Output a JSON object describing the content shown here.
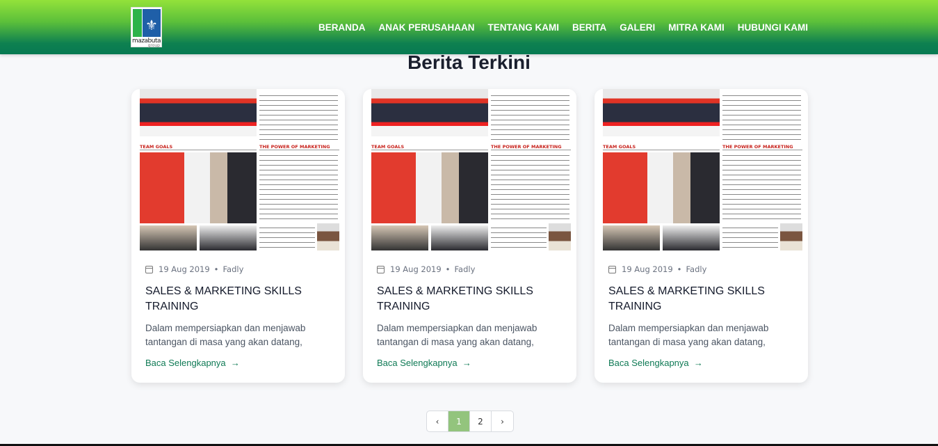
{
  "header": {
    "logo_text": "mazabuta",
    "logo_subtext": "group",
    "nav": [
      "BERANDA",
      "ANAK PERUSAHAAN",
      "TENTANG KAMI",
      "BERITA",
      "GALERI",
      "MITRA KAMI",
      "HUBUNGI KAMI"
    ]
  },
  "section_title": "Berita Terkini",
  "cards": [
    {
      "image_headings": [
        "TEAM GOALS",
        "THE POWER OF MARKETING"
      ],
      "date": "19 Aug 2019",
      "author": "Fadly",
      "title": "SALES & MARKETING SKILLS TRAINING",
      "excerpt": "Dalam mempersiapkan dan menjawab tantangan di masa yang akan datang,",
      "link": "Baca Selengkapnya"
    },
    {
      "image_headings": [
        "TEAM GOALS",
        "THE POWER OF MARKETING"
      ],
      "date": "19 Aug 2019",
      "author": "Fadly",
      "title": "SALES & MARKETING SKILLS TRAINING",
      "excerpt": "Dalam mempersiapkan dan menjawab tantangan di masa yang akan datang,",
      "link": "Baca Selengkapnya"
    },
    {
      "image_headings": [
        "TEAM GOALS",
        "THE POWER OF MARKETING"
      ],
      "date": "19 Aug 2019",
      "author": "Fadly",
      "title": "SALES & MARKETING SKILLS TRAINING",
      "excerpt": "Dalam mempersiapkan dan menjawab tantangan di masa yang akan datang,",
      "link": "Baca Selengkapnya"
    }
  ],
  "pagination": {
    "prev": "‹",
    "pages": [
      "1",
      "2"
    ],
    "current": "1",
    "next": "›"
  },
  "colors": {
    "accent": "#0f7a55",
    "active_page": "#93c47d"
  }
}
